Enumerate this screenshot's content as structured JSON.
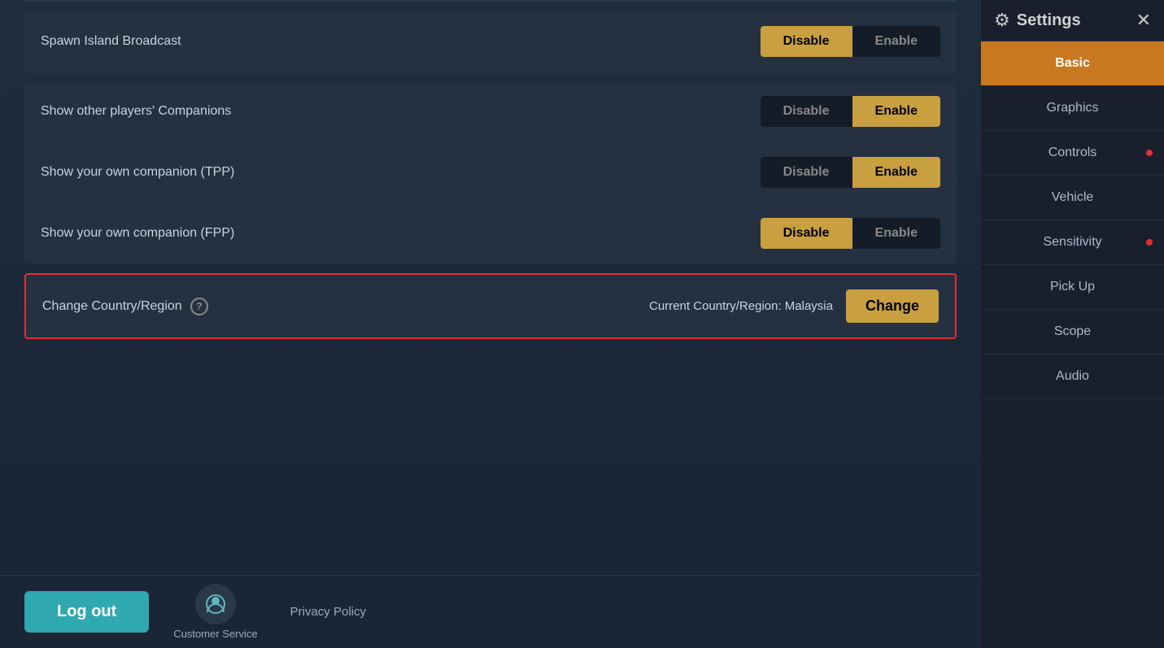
{
  "main": {
    "rows": [
      {
        "id": "spawn-island",
        "label": "Spawn Island Broadcast",
        "disable_state": "active",
        "enable_state": "inactive"
      }
    ],
    "companions_section": [
      {
        "id": "other-companions",
        "label": "Show other players' Companions",
        "disable_state": "inactive",
        "enable_state": "active"
      },
      {
        "id": "own-companion-tpp",
        "label": "Show your own companion (TPP)",
        "disable_state": "inactive",
        "enable_state": "active"
      },
      {
        "id": "own-companion-fpp",
        "label": "Show your own companion (FPP)",
        "disable_state": "active",
        "enable_state": "inactive"
      }
    ],
    "country_region": {
      "label": "Change Country/Region",
      "current_value_label": "Current Country/Region: Malaysia",
      "change_button_label": "Change",
      "highlighted": true
    },
    "bottom": {
      "logout_label": "Log out",
      "customer_service_label": "Customer Service",
      "privacy_policy_label": "Privacy Policy"
    }
  },
  "settings_panel": {
    "header": {
      "title": "Settings",
      "gear_icon": "⚙",
      "close_icon": "✕"
    },
    "nav_items": [
      {
        "id": "basic",
        "label": "Basic",
        "active": true,
        "has_dot": false
      },
      {
        "id": "graphics",
        "label": "Graphics",
        "active": false,
        "has_dot": false
      },
      {
        "id": "controls",
        "label": "Controls",
        "active": false,
        "has_dot": true
      },
      {
        "id": "vehicle",
        "label": "Vehicle",
        "active": false,
        "has_dot": false
      },
      {
        "id": "sensitivity",
        "label": "Sensitivity",
        "active": false,
        "has_dot": true
      },
      {
        "id": "pick-up",
        "label": "Pick Up",
        "active": false,
        "has_dot": false
      },
      {
        "id": "scope",
        "label": "Scope",
        "active": false,
        "has_dot": false
      },
      {
        "id": "audio",
        "label": "Audio",
        "active": false,
        "has_dot": false
      }
    ]
  },
  "toggle_labels": {
    "disable": "Disable",
    "enable": "Enable"
  }
}
